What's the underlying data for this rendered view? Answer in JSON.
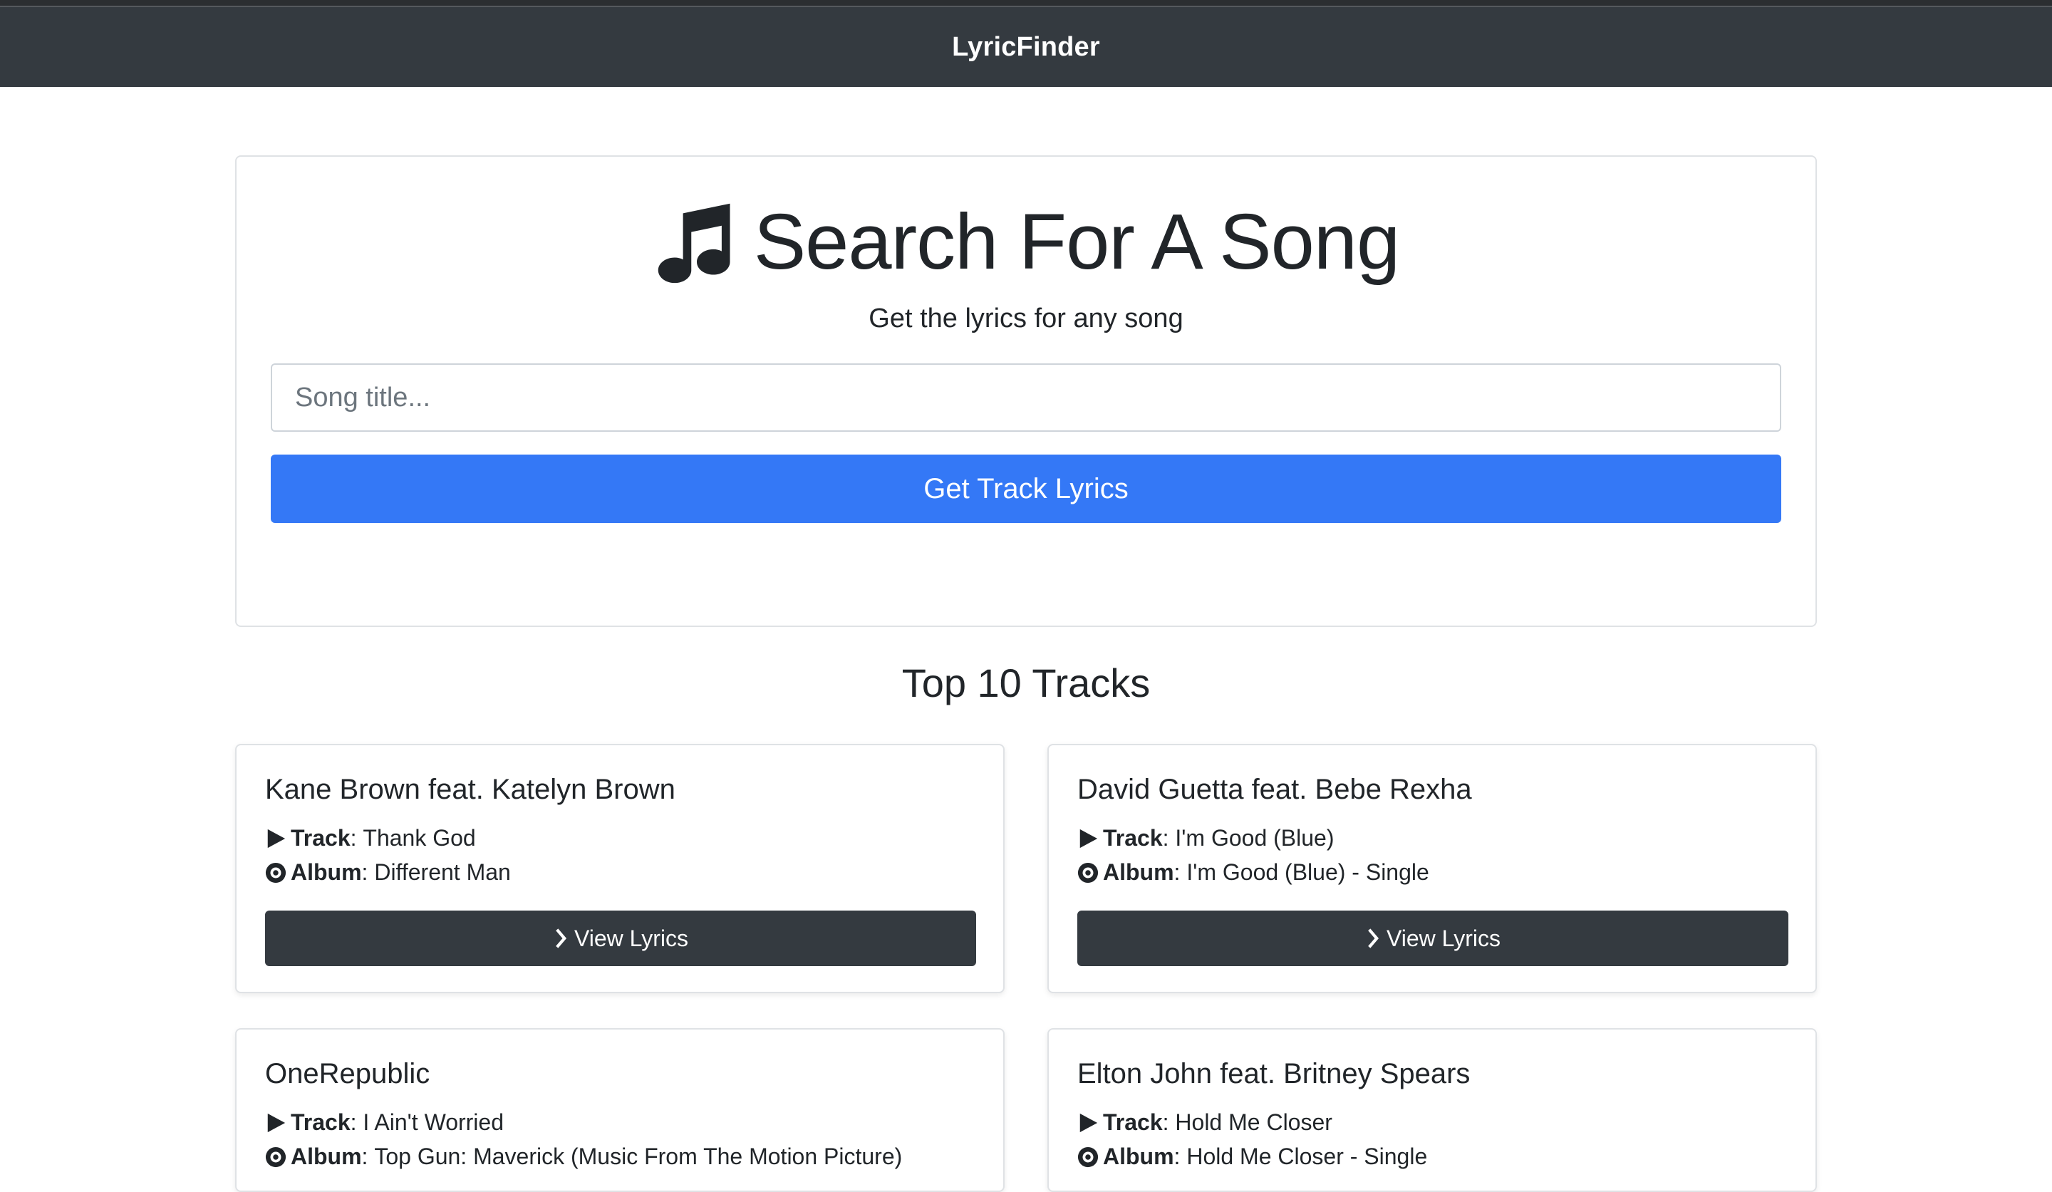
{
  "navbar": {
    "brand": "LyricFinder"
  },
  "search": {
    "title": "Search For A Song",
    "subtitle": "Get the lyrics for any song",
    "placeholder": "Song title...",
    "button_label": "Get Track Lyrics",
    "icon": "music-note-icon"
  },
  "top_tracks": {
    "heading": "Top 10 Tracks",
    "track_label": "Track",
    "album_label": "Album",
    "view_label": "View Lyrics",
    "items": [
      {
        "artist": "Kane Brown feat. Katelyn Brown",
        "track": "Thank God",
        "album": "Different Man"
      },
      {
        "artist": "David Guetta feat. Bebe Rexha",
        "track": "I'm Good (Blue)",
        "album": "I'm Good (Blue) - Single"
      },
      {
        "artist": "OneRepublic",
        "track": "I Ain't Worried",
        "album": "Top Gun: Maverick (Music From The Motion Picture)"
      },
      {
        "artist": "Elton John feat. Britney Spears",
        "track": "Hold Me Closer",
        "album": "Hold Me Closer - Single"
      }
    ]
  },
  "colors": {
    "navbar_bg": "#343a40",
    "primary": "#3478f6",
    "dark_button": "#343a40"
  }
}
